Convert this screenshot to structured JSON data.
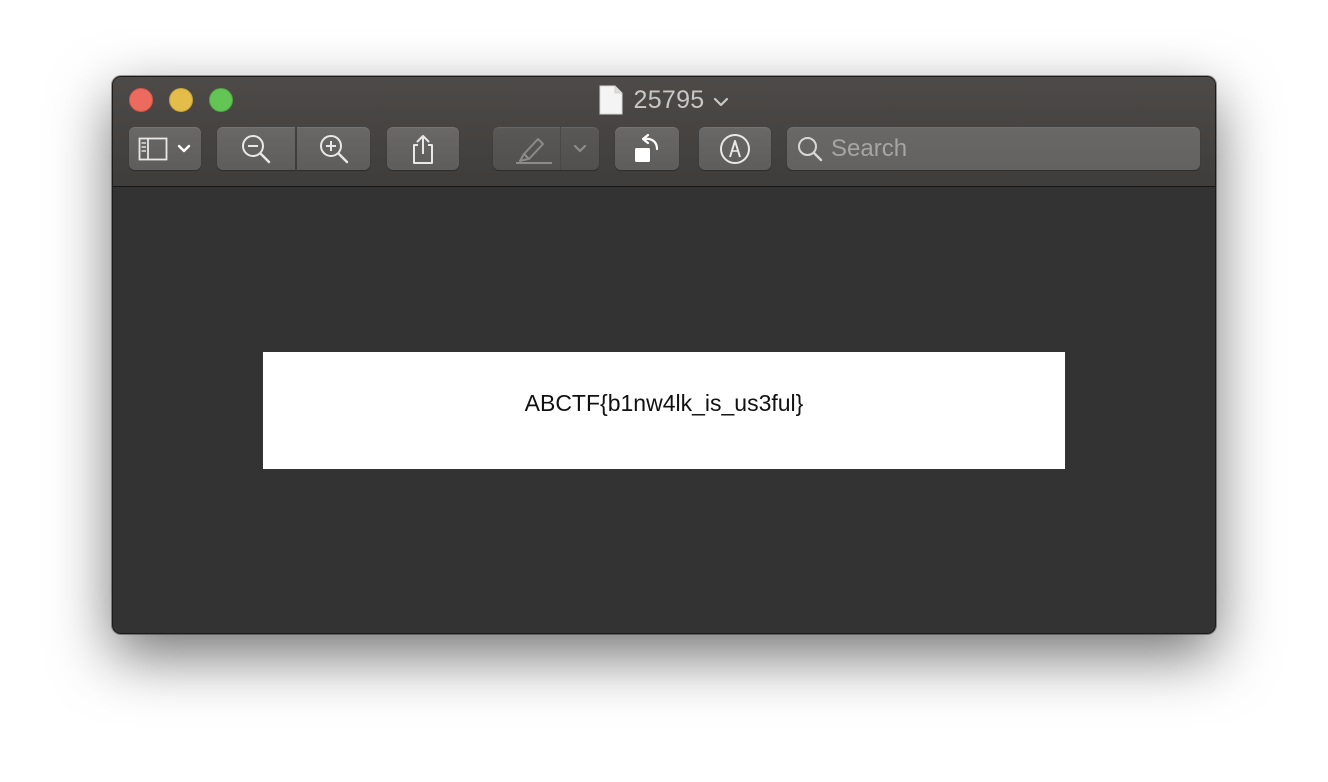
{
  "window": {
    "title": "25795"
  },
  "toolbar": {
    "buttons": [
      {
        "name": "sidebar-toggle",
        "icon": "sidebar-icon"
      },
      {
        "name": "zoom-out",
        "icon": "zoom-out-icon"
      },
      {
        "name": "zoom-in",
        "icon": "zoom-in-icon"
      },
      {
        "name": "share",
        "icon": "share-icon"
      },
      {
        "name": "highlight",
        "icon": "highlighter-icon",
        "enabled": false
      },
      {
        "name": "rotate",
        "icon": "rotate-left-icon"
      },
      {
        "name": "markup",
        "icon": "markup-pen-icon"
      }
    ],
    "search": {
      "placeholder": "Search",
      "value": ""
    }
  },
  "document": {
    "text": "ABCTF{b1nw4lk_is_us3ful}"
  },
  "colors": {
    "close": "#ed6a5e",
    "minimize": "#e3bc4a",
    "zoom": "#62c554",
    "window_background": "#333333",
    "page_background": "#ffffff"
  }
}
